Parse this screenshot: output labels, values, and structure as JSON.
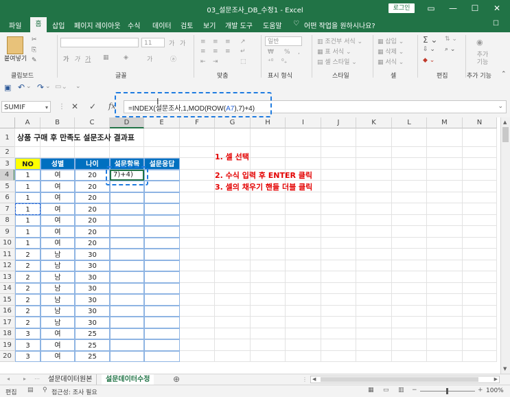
{
  "window": {
    "title": "03_설문조사_DB_수정1  -  Excel",
    "login": "로그인"
  },
  "menu": {
    "tabs": [
      "파일",
      "홈",
      "삽입",
      "페이지 레이아웃",
      "수식",
      "데이터",
      "검토",
      "보기",
      "개발 도구",
      "도움말"
    ],
    "tell_me": "어떤 작업을 원하시나요?"
  },
  "ribbon": {
    "groups": [
      "클립보드",
      "글꼴",
      "맞춤",
      "표시 형식",
      "스타일",
      "셀",
      "편집",
      "추가 기능"
    ],
    "paste_label": "붙여넣기",
    "number_format": "일반",
    "conditional_format": "조건부 서식",
    "format_as_table": "표 서식",
    "cell_styles": "셀 스타일",
    "insert": "삽입",
    "delete": "삭제",
    "format": "서식",
    "addin": "추가 기능",
    "font_size": "11",
    "percent": "%",
    "thousands": ","
  },
  "formula_bar": {
    "name_box": "SUMIF",
    "fx": "fx",
    "formula_pre": "=INDEX(설문조사,1,MOD(ROW(",
    "formula_ref": "A7",
    "formula_post": "),7)+4)"
  },
  "sheet": {
    "columns": [
      "A",
      "B",
      "C",
      "D",
      "E",
      "F",
      "G",
      "H",
      "I",
      "J",
      "K",
      "L",
      "M",
      "N"
    ],
    "rows": [
      "1",
      "2",
      "3",
      "4",
      "5",
      "6",
      "7",
      "8",
      "9",
      "10",
      "11",
      "12",
      "13",
      "14",
      "15",
      "16",
      "17",
      "18",
      "19",
      "20"
    ],
    "title": "상품 구매 후 만족도 설문조사 결과표",
    "headers": [
      "NO",
      "성별",
      "나이",
      "설문항목",
      "설문응답"
    ],
    "data": [
      {
        "no": "1",
        "gender": "여",
        "age": "20"
      },
      {
        "no": "1",
        "gender": "여",
        "age": "20"
      },
      {
        "no": "1",
        "gender": "여",
        "age": "20"
      },
      {
        "no": "1",
        "gender": "여",
        "age": "20"
      },
      {
        "no": "1",
        "gender": "여",
        "age": "20"
      },
      {
        "no": "1",
        "gender": "여",
        "age": "20"
      },
      {
        "no": "1",
        "gender": "여",
        "age": "20"
      },
      {
        "no": "2",
        "gender": "남",
        "age": "30"
      },
      {
        "no": "2",
        "gender": "남",
        "age": "30"
      },
      {
        "no": "2",
        "gender": "남",
        "age": "30"
      },
      {
        "no": "2",
        "gender": "남",
        "age": "30"
      },
      {
        "no": "2",
        "gender": "남",
        "age": "30"
      },
      {
        "no": "2",
        "gender": "남",
        "age": "30"
      },
      {
        "no": "2",
        "gender": "남",
        "age": "30"
      },
      {
        "no": "3",
        "gender": "여",
        "age": "25"
      },
      {
        "no": "3",
        "gender": "여",
        "age": "25"
      },
      {
        "no": "3",
        "gender": "여",
        "age": "25"
      }
    ],
    "editing_cell": "7)+4)",
    "instructions": [
      "1. 셀 선택",
      "2. 수식 입력 후 ENTER 클릭",
      "3. 셀의 채우기 핸들 더블 클릭"
    ]
  },
  "sheet_tabs": [
    "설문데이터원본",
    "설문데이터수정"
  ],
  "status": {
    "mode": "편집",
    "accessibility": "접근성: 조사 필요",
    "zoom": "100%"
  },
  "colors": {
    "excel_green": "#217346",
    "header_blue": "#0070c0",
    "no_yellow": "#ffff00",
    "instruction_red": "#e30000",
    "dash_blue": "#1e7be0"
  }
}
